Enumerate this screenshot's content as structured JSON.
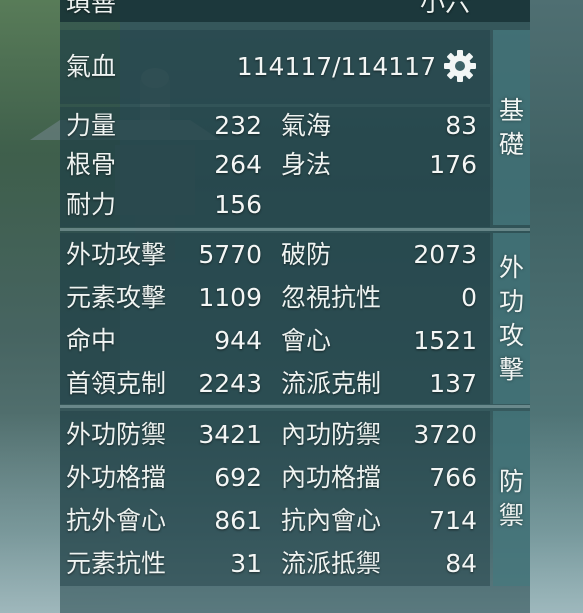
{
  "top": {
    "left": "瑣善",
    "right": "小六"
  },
  "hp": {
    "label": "氣血",
    "value": "114117/114117",
    "icon": "gear-icon"
  },
  "tabs": {
    "basic": [
      "基",
      "礎"
    ],
    "attack": [
      "外",
      "功",
      "攻",
      "擊"
    ],
    "defense": [
      "防",
      "禦"
    ]
  },
  "basic": [
    {
      "label": "力量",
      "value": "232"
    },
    {
      "label": "氣海",
      "value": "83"
    },
    {
      "label": "根骨",
      "value": "264"
    },
    {
      "label": "身法",
      "value": "176"
    },
    {
      "label": "耐力",
      "value": "156"
    }
  ],
  "attack": [
    {
      "label": "外功攻擊",
      "value": "5770"
    },
    {
      "label": "破防",
      "value": "2073"
    },
    {
      "label": "元素攻擊",
      "value": "1109"
    },
    {
      "label": "忽視抗性",
      "value": "0"
    },
    {
      "label": "命中",
      "value": "944"
    },
    {
      "label": "會心",
      "value": "1521"
    },
    {
      "label": "首領克制",
      "value": "2243"
    },
    {
      "label": "流派克制",
      "value": "137"
    }
  ],
  "defense": [
    {
      "label": "外功防禦",
      "value": "3421"
    },
    {
      "label": "內功防禦",
      "value": "3720"
    },
    {
      "label": "外功格擋",
      "value": "692"
    },
    {
      "label": "內功格擋",
      "value": "766"
    },
    {
      "label": "抗外會心",
      "value": "861"
    },
    {
      "label": "抗內會心",
      "value": "714"
    },
    {
      "label": "元素抗性",
      "value": "31"
    },
    {
      "label": "流派抵禦",
      "value": "84"
    }
  ],
  "colors": {
    "panel": "#23464b",
    "tab": "#46787d",
    "text": "#eef3f1"
  }
}
